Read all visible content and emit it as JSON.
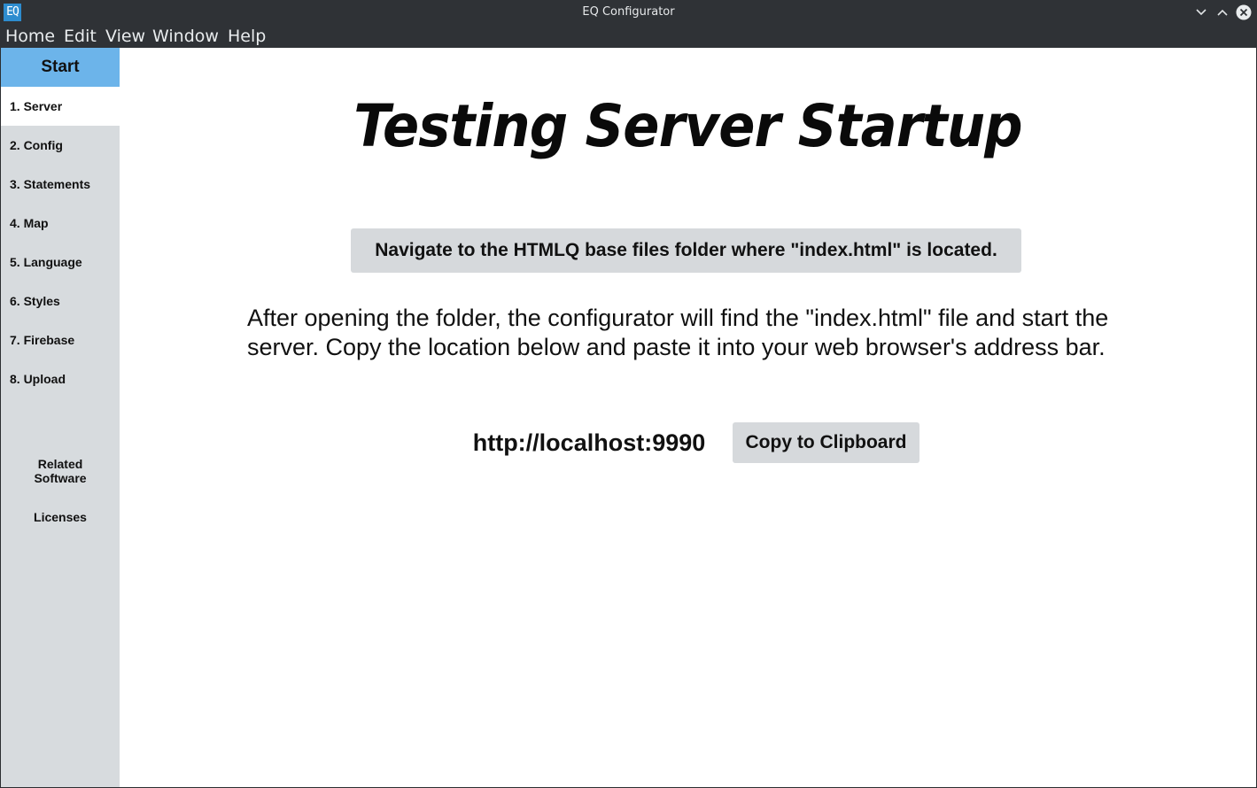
{
  "window": {
    "icon_text": "EQ",
    "title": "EQ Configurator",
    "minimize_icon": "chevron-down-icon",
    "maximize_icon": "chevron-up-icon",
    "close_icon": "close-icon"
  },
  "menubar": {
    "items": [
      "Home",
      "Edit",
      "View",
      "Window",
      "Help"
    ]
  },
  "sidebar": {
    "start_label": "Start",
    "items": [
      {
        "label": "1. Server",
        "active": true
      },
      {
        "label": "2. Config",
        "active": false
      },
      {
        "label": "3. Statements",
        "active": false
      },
      {
        "label": "4. Map",
        "active": false
      },
      {
        "label": "5. Language",
        "active": false
      },
      {
        "label": "6. Styles",
        "active": false
      },
      {
        "label": "7. Firebase",
        "active": false
      },
      {
        "label": "8. Upload",
        "active": false
      }
    ],
    "related_software_line1": "Related",
    "related_software_line2": "Software",
    "licenses": "Licenses"
  },
  "main": {
    "heading": "Testing Server Startup",
    "navigate_button": "Navigate to the HTMLQ base files folder where \"index.html\" is located.",
    "instructions": "After opening the folder, the configurator will find the \"index.html\" file and start the server. Copy the location below and paste it into your web browser's address bar.",
    "server_url": "http://localhost:9990",
    "copy_button": "Copy to Clipboard"
  },
  "colors": {
    "sidebar_bg": "#d7dbde",
    "start_bg": "#6cb4ea",
    "button_bg": "#d6d9dc",
    "titlebar_bg": "#2f3236"
  }
}
